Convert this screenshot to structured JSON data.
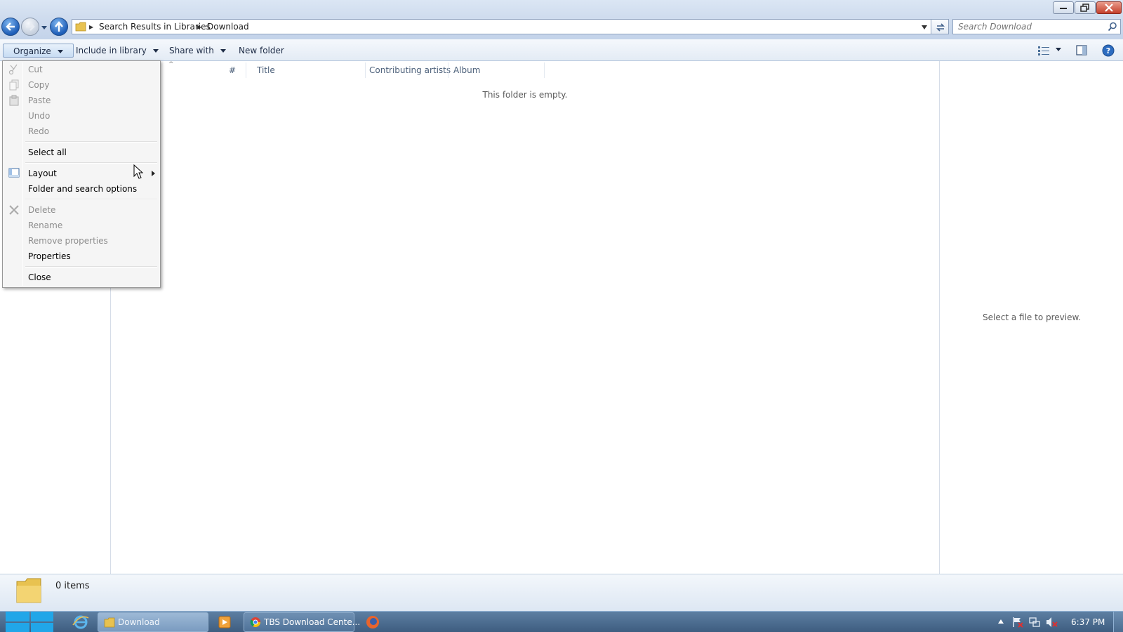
{
  "window": {
    "caption_buttons": [
      "minimize",
      "maximize",
      "close"
    ]
  },
  "address": {
    "crumbs": [
      "Search Results in Libraries",
      "Download"
    ]
  },
  "search": {
    "placeholder": "Search Download"
  },
  "toolbar": {
    "organize": "Organize",
    "include_in_library": "Include in library",
    "share_with": "Share with",
    "new_folder": "New folder"
  },
  "columns": [
    "#",
    "Title",
    "Contributing artists",
    "Album"
  ],
  "file_list": {
    "empty_message": "This folder is empty."
  },
  "preview": {
    "message": "Select a file to preview."
  },
  "details": {
    "item_count": "0 items"
  },
  "organize_menu": {
    "items": [
      {
        "label": "Cut",
        "enabled": false,
        "icon": "scissors-icon"
      },
      {
        "label": "Copy",
        "enabled": false,
        "icon": "copy-icon"
      },
      {
        "label": "Paste",
        "enabled": false,
        "icon": "clipboard-icon"
      },
      {
        "label": "Undo",
        "enabled": false
      },
      {
        "label": "Redo",
        "enabled": false
      },
      {
        "label": "Select all",
        "enabled": true
      },
      {
        "label": "Layout",
        "enabled": true,
        "icon": "layout-icon",
        "submenu": true
      },
      {
        "label": "Folder and search options",
        "enabled": true
      },
      {
        "label": "Delete",
        "enabled": false,
        "icon": "delete-x-icon"
      },
      {
        "label": "Rename",
        "enabled": false
      },
      {
        "label": "Remove properties",
        "enabled": false
      },
      {
        "label": "Properties",
        "enabled": true
      },
      {
        "label": "Close",
        "enabled": true
      }
    ]
  },
  "taskbar": {
    "buttons": [
      {
        "label": "Download",
        "icon": "folder-icon"
      },
      {
        "label": "TBS Download Cente...",
        "icon": "chrome-icon"
      }
    ],
    "pinned": [
      "ie-icon",
      "media-player-icon",
      "firefox-icon"
    ],
    "clock": "6:37 PM"
  },
  "colors": {
    "accent": "#1e5eb8",
    "taskbar": "#4f7298",
    "menu_background": "#f5f5f5",
    "disabled_text": "#8d8d8d"
  }
}
